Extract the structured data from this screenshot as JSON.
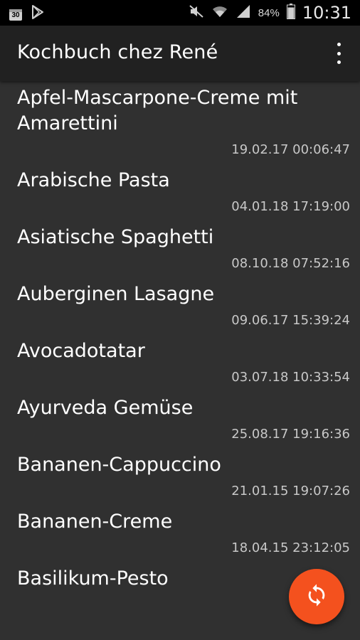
{
  "status_bar": {
    "left_icons": [
      "calendar-30-icon",
      "play-store-icon"
    ],
    "right_icons": [
      "mute-icon",
      "wifi-icon",
      "signal-icon"
    ],
    "calendar_day": "30",
    "battery_percent": "84%",
    "battery_level": 0.84,
    "time": "10:31"
  },
  "app_bar": {
    "title": "Kochbuch chez René",
    "menu_icon": "more-vert-icon"
  },
  "recipes": [
    {
      "title": "Apfel-Mascarpone-Creme mit Amarettini",
      "date": "19.02.17 00:06:47"
    },
    {
      "title": "Arabische Pasta",
      "date": "04.01.18 17:19:00"
    },
    {
      "title": "Asiatische Spaghetti",
      "date": "08.10.18 07:52:16"
    },
    {
      "title": "Auberginen Lasagne",
      "date": "09.06.17 15:39:24"
    },
    {
      "title": "Avocadotatar",
      "date": "03.07.18 10:33:54"
    },
    {
      "title": "Ayurveda Gemüse",
      "date": "25.08.17 19:16:36"
    },
    {
      "title": "Bananen-Cappuccino",
      "date": "21.01.15 19:07:26"
    },
    {
      "title": "Bananen-Creme",
      "date": "18.04.15 23:12:05"
    },
    {
      "title": "Basilikum-Pesto",
      "date": ""
    }
  ],
  "fab": {
    "icon": "sync-icon",
    "color": "#f4511e"
  },
  "colors": {
    "background": "#303030",
    "app_bar": "#212121",
    "status_bar": "#000000",
    "accent": "#f4511e"
  }
}
